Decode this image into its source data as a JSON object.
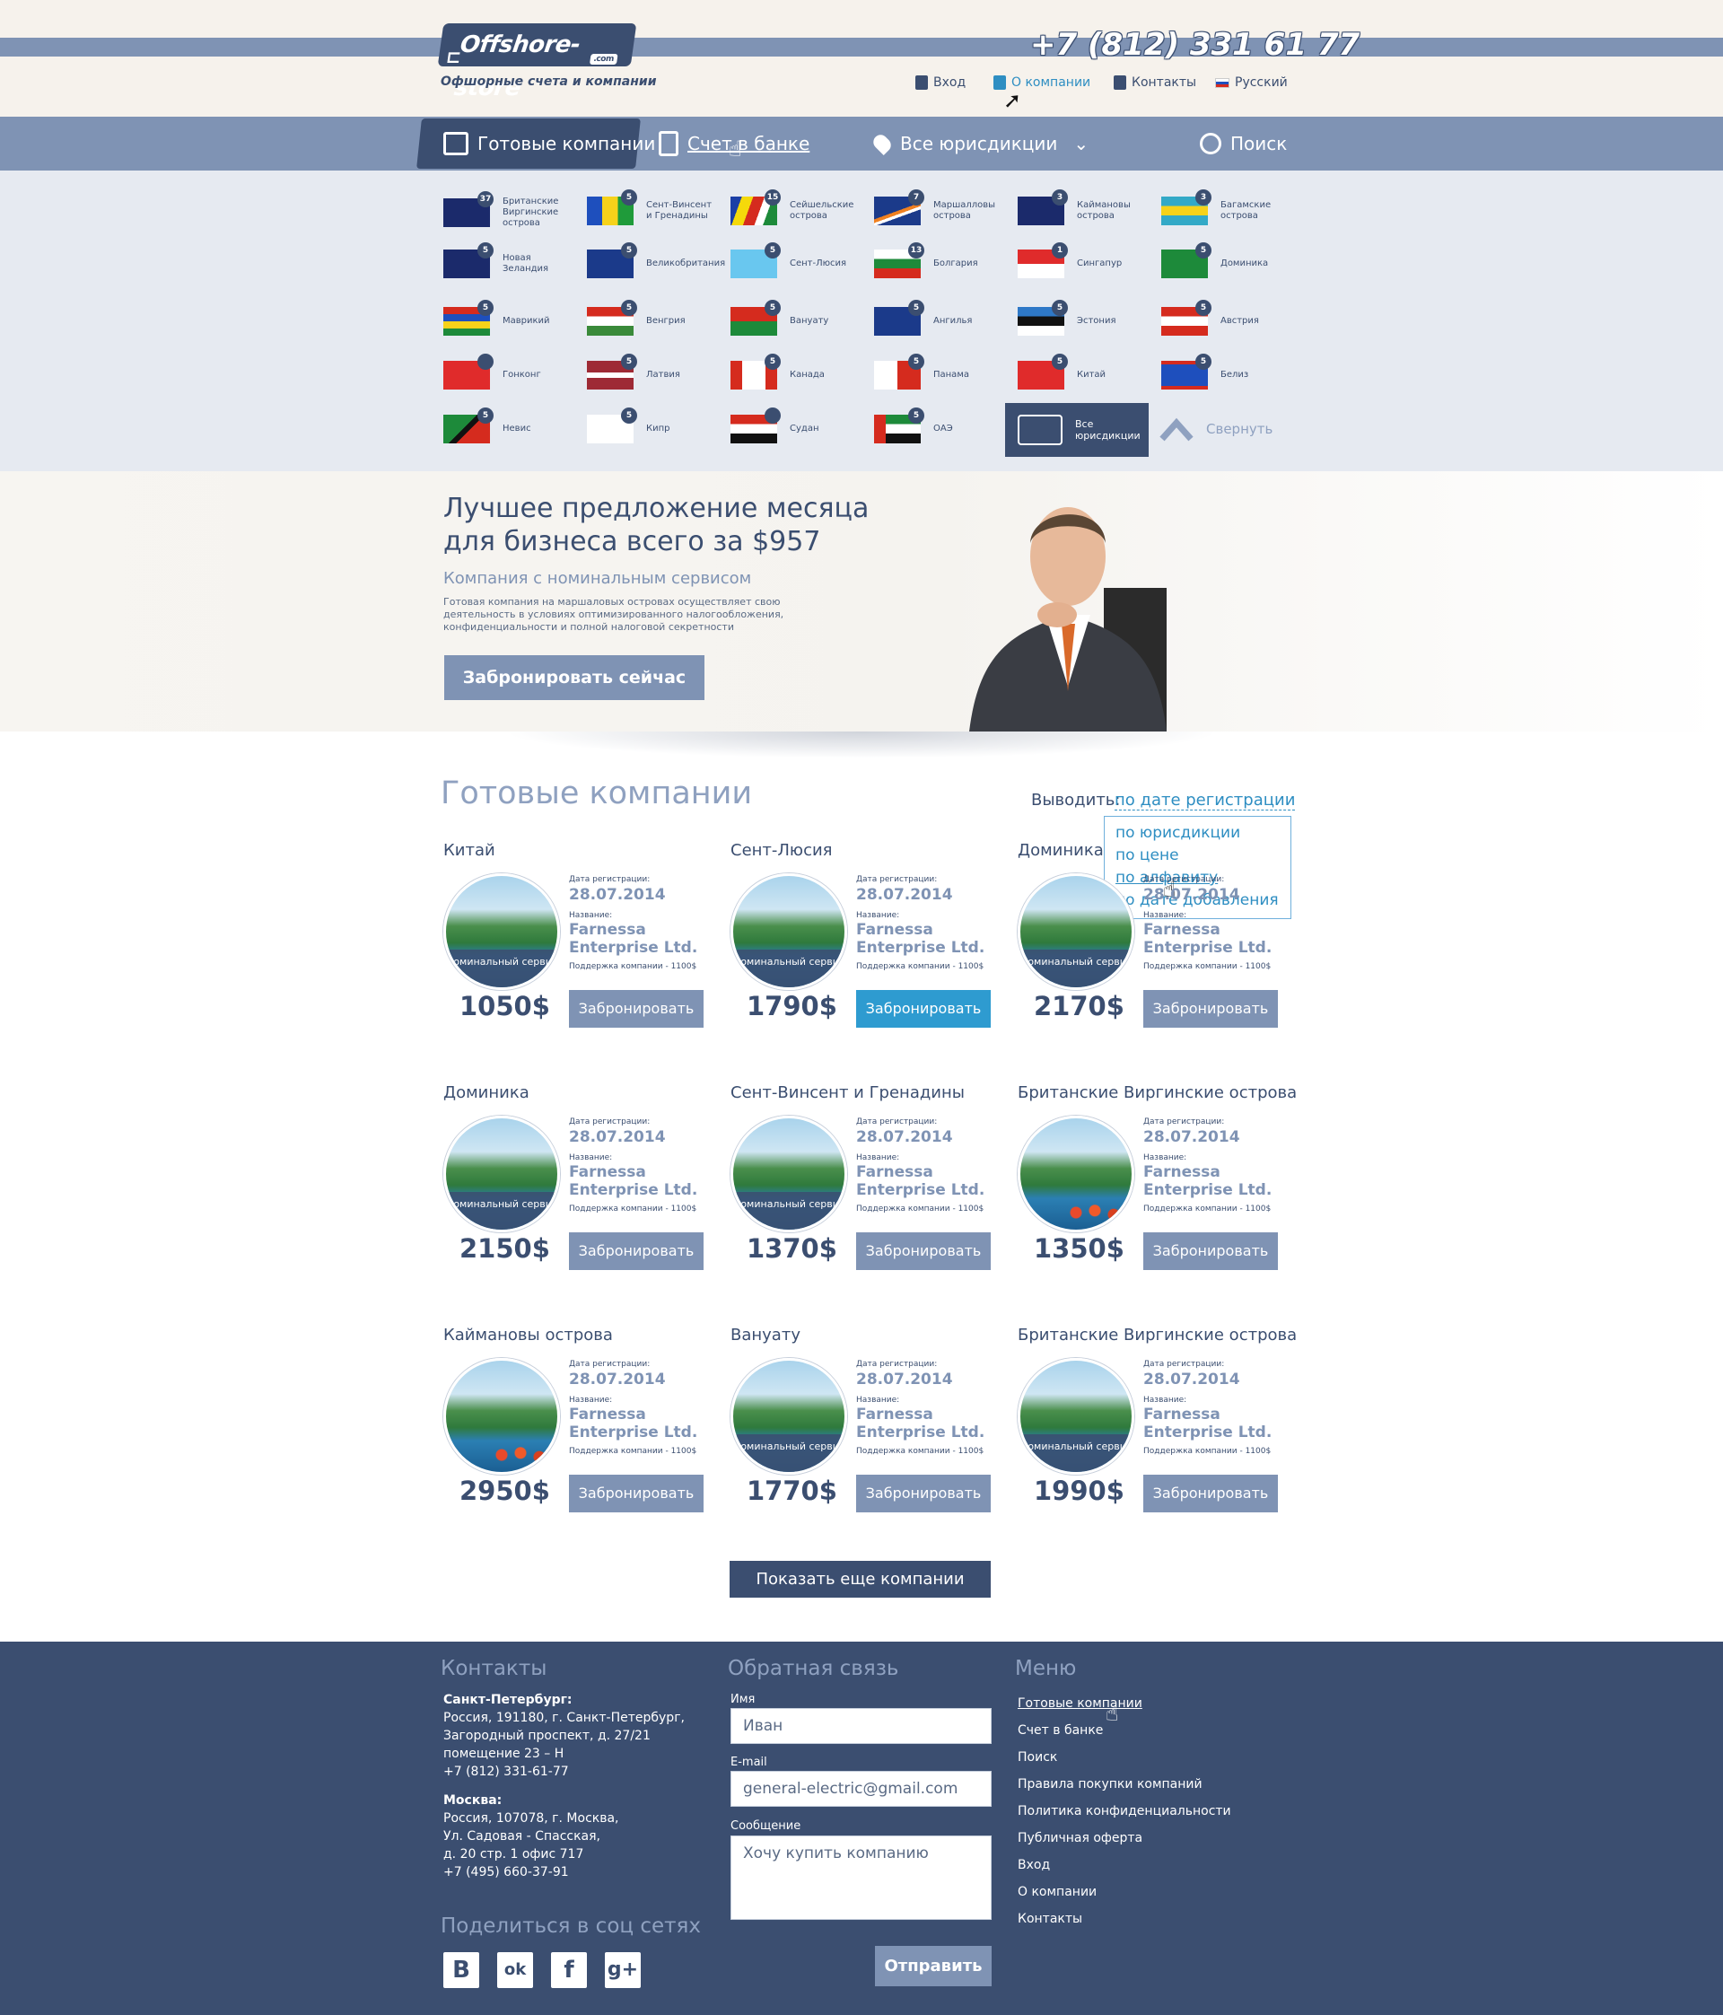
{
  "header": {
    "logo": "Offshore-store",
    "logo_suffix": ".com",
    "tagline": "Офшорные счета и компании",
    "phone": "+7 (812) 331 61 77",
    "links": [
      {
        "label": "Вход",
        "icon": "login-icon"
      },
      {
        "label": "О компании",
        "icon": "people-icon"
      },
      {
        "label": "Контакты",
        "icon": "contacts-icon"
      },
      {
        "label": "Русский",
        "icon": "flag-ru-icon"
      }
    ]
  },
  "nav": {
    "items": [
      {
        "label": "Готовые компании",
        "icon": "briefcase-icon"
      },
      {
        "label": "Счет в банке",
        "icon": "clipboard-icon"
      },
      {
        "label": "Все юрисдикции",
        "icon": "pin-icon"
      }
    ],
    "search": "Поиск"
  },
  "jurisdictions": [
    {
      "name": "Британские Виргинские острова",
      "count": "37"
    },
    {
      "name": "Сент-Винсент и Гренадины",
      "count": "5"
    },
    {
      "name": "Сейшельские острова",
      "count": "15"
    },
    {
      "name": "Маршалловы острова",
      "count": "7"
    },
    {
      "name": "Каймановы острова",
      "count": "3"
    },
    {
      "name": "Багамские острова",
      "count": "3"
    },
    {
      "name": "Новая Зеландия",
      "count": "5"
    },
    {
      "name": "Великобритания",
      "count": "5"
    },
    {
      "name": "Сент-Люсия",
      "count": "5"
    },
    {
      "name": "Болгария",
      "count": "13"
    },
    {
      "name": "Сингапур",
      "count": "1"
    },
    {
      "name": "Доминика",
      "count": "5"
    },
    {
      "name": "Маврикий",
      "count": "5"
    },
    {
      "name": "Венгрия",
      "count": "5"
    },
    {
      "name": "Вануату",
      "count": "5"
    },
    {
      "name": "Ангилья",
      "count": "5"
    },
    {
      "name": "Эстония",
      "count": "5"
    },
    {
      "name": "Австрия",
      "count": "5"
    },
    {
      "name": "Гонконг",
      "count": ""
    },
    {
      "name": "Латвия",
      "count": "5"
    },
    {
      "name": "Канада",
      "count": "5"
    },
    {
      "name": "Панама",
      "count": "5"
    },
    {
      "name": "Китай",
      "count": "5"
    },
    {
      "name": "Белиз",
      "count": "5"
    },
    {
      "name": "Невис",
      "count": "5"
    },
    {
      "name": "Кипр",
      "count": "5"
    },
    {
      "name": "Судан",
      "count": ""
    },
    {
      "name": "ОАЭ",
      "count": "5"
    }
  ],
  "all_jurisdictions": "Все юрисдикции",
  "collapse": "Свернуть",
  "hero": {
    "title": "Лучшее предложение месяца для бизнеса всего за $957",
    "subtitle": "Компания с номинальным сервисом",
    "description": "Готовая компания на маршаловых островах осуществляет свою деятельность в условиях оптимизированного налогообложения, конфиденциальности и полной налоговой секретности",
    "button": "Забронировать сейчас"
  },
  "companies_section": {
    "title": "Готовые компании",
    "sort_label": "Выводить:",
    "sort_value": "по дате регистрации",
    "sort_options": [
      "по юрисдикции",
      "по цене",
      "по алфавиту",
      "по дате добавления"
    ],
    "date_label": "Дата регистрации:",
    "name_label": "Название:",
    "badge": "Номинальный сервис",
    "book": "Забронировать",
    "show_more": "Показать еще компании"
  },
  "companies": [
    {
      "country": "Китай",
      "date": "28.07.2014",
      "name": "Farnessa Enterprise Ltd.",
      "support": "Поддержка компании - 1100$",
      "price": "1050$",
      "badge": true
    },
    {
      "country": "Сент-Люсия",
      "date": "28.07.2014",
      "name": "Farnessa Enterprise Ltd.",
      "support": "Поддержка компании - 1100$",
      "price": "1790$",
      "badge": true
    },
    {
      "country": "Доминика",
      "date": "28.07.2014",
      "name": "Farnessa Enterprise Ltd.",
      "support": "Поддержка компании - 1100$",
      "price": "2170$",
      "badge": true
    },
    {
      "country": "Доминика",
      "date": "28.07.2014",
      "name": "Farnessa Enterprise Ltd.",
      "support": "Поддержка компании - 1100$",
      "price": "2150$",
      "badge": true
    },
    {
      "country": "Сент-Винсент и Гренадины",
      "date": "28.07.2014",
      "name": "Farnessa Enterprise Ltd.",
      "support": "Поддержка компании - 1100$",
      "price": "1370$",
      "badge": true
    },
    {
      "country": "Британские Виргинские острова",
      "date": "28.07.2014",
      "name": "Farnessa Enterprise Ltd.",
      "support": "Поддержка компании - 1100$",
      "price": "1350$",
      "badge": false
    },
    {
      "country": "Каймановы острова",
      "date": "28.07.2014",
      "name": "Farnessa Enterprise Ltd.",
      "support": "Поддержка компании - 1100$",
      "price": "2950$",
      "badge": false
    },
    {
      "country": "Вануату",
      "date": "28.07.2014",
      "name": "Farnessa Enterprise Ltd.",
      "support": "Поддержка компании - 1100$",
      "price": "1770$",
      "badge": true
    },
    {
      "country": "Британские Виргинские острова",
      "date": "28.07.2014",
      "name": "Farnessa Enterprise Ltd.",
      "support": "Поддержка компании - 1100$",
      "price": "1990$",
      "badge": true
    }
  ],
  "footer": {
    "contacts_title": "Контакты",
    "spb_title": "Санкт-Петербург:",
    "spb_lines": [
      "Россия, 191180, г. Санкт-Петербург,",
      "Загородный проспект, д. 27/21",
      "помещение 23 – Н",
      "+7 (812) 331-61-77"
    ],
    "msk_title": "Москва:",
    "msk_lines": [
      "Россия, 107078, г. Москва,",
      "Ул. Садовая - Спасская,",
      "д. 20 стр. 1 офис 717",
      "+7 (495) 660-37-91"
    ],
    "share_title": "Поделиться в соц сетях",
    "social": [
      {
        "label": "B",
        "icon": "vk-icon"
      },
      {
        "label": "ok",
        "icon": "odnoklassniki-icon"
      },
      {
        "label": "f",
        "icon": "facebook-icon"
      },
      {
        "label": "g+",
        "icon": "google-plus-icon"
      }
    ],
    "feedback_title": "Обратная связь",
    "name_label": "Имя",
    "name_value": "Иван",
    "email_label": "E-mail",
    "email_value": "general-electric@gmail.com",
    "message_label": "Сообщение",
    "message_value": "Хочу купить компанию",
    "send": "Отправить",
    "menu_title": "Меню",
    "menu": [
      "Готовые компании",
      "Счет в банке",
      "Поиск",
      "Правила покупки компаний",
      "Политика конфиденциальности",
      "Публичная оферта",
      "Вход",
      "О компании",
      "Контакты"
    ]
  },
  "colors": {
    "dark": "#3b4e70",
    "accent": "#7f93b4",
    "link": "#2e8ec2",
    "hover": "#2e9bd0"
  }
}
